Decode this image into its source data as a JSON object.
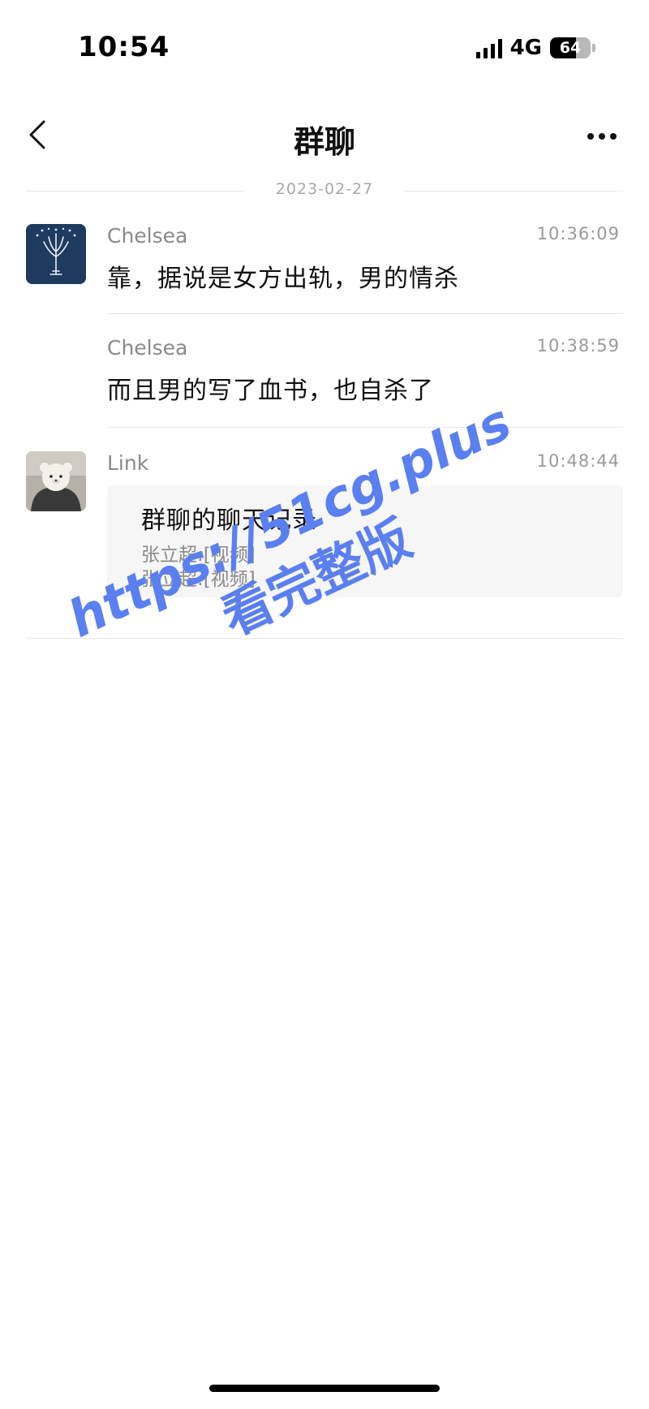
{
  "status_bar": {
    "time": "10:54",
    "network": "4G",
    "battery_level": "64",
    "battery_fraction": 0.64,
    "icons": [
      "signal-icon",
      "battery-icon"
    ]
  },
  "nav": {
    "title": "群聊",
    "back_icon": "chevron-left-icon",
    "more_icon": "more-horizontal-icon"
  },
  "date_divider": "2023-02-27",
  "messages": [
    {
      "sender": "Chelsea",
      "time": "10:36:09",
      "text": "靠，据说是女方出轨，男的情杀",
      "avatar": "tree-avatar"
    },
    {
      "sender": "Chelsea",
      "time": "10:38:59",
      "text": "而且男的写了血书，也自杀了"
    },
    {
      "sender": "Link",
      "time": "10:48:44",
      "avatar": "plush-toy-avatar",
      "forward": {
        "title": "群聊的聊天记录",
        "lines": [
          "张立超:[视频]",
          "张立超:[视频]"
        ]
      }
    }
  ],
  "watermark": {
    "url": "https://51cg.plus",
    "cta": "看完整版"
  },
  "colors": {
    "watermark": "#5a7ff0",
    "muted_text": "#8a8a8a",
    "card_bg": "#f6f6f6"
  }
}
